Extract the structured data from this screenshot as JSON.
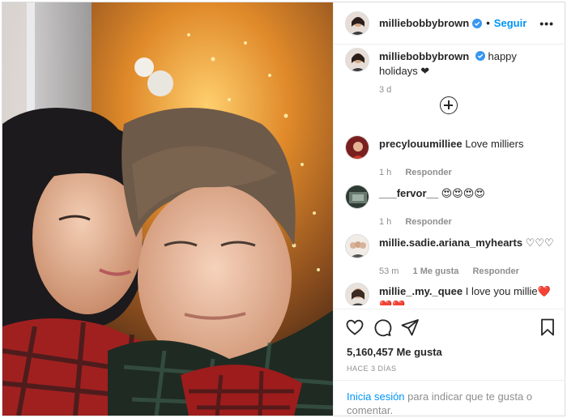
{
  "post": {
    "username": "milliebobbybrown",
    "follow_label": "Seguir",
    "separator": "•",
    "more_label": "•••",
    "photo_description_icon": "photo"
  },
  "caption": {
    "username": "milliebobbybrown",
    "text": "happy holidays ❤",
    "age": "3 d"
  },
  "comments": [
    {
      "username": "precylouumilliee",
      "text": "Love milliers",
      "age": "1 h",
      "likes": "",
      "reply": "Responder"
    },
    {
      "username": "___fervor__",
      "text": "😍😍😍😍",
      "age": "1 h",
      "likes": "",
      "reply": "Responder"
    },
    {
      "username": "millie.sadie.ariana_myhearts",
      "text": "♡♡♡",
      "age": "53 m",
      "likes": "1 Me gusta",
      "reply": "Responder"
    },
    {
      "username": "millie_.my._quee",
      "text": "I love you millie",
      "hearts": "❤️❤️❤️",
      "age": "",
      "likes": "",
      "reply": ""
    }
  ],
  "likes_text": "5,160,457 Me gusta",
  "timestamp": "HACE 3 DÍAS",
  "login": {
    "link": "Inicia sesión",
    "rest": " para indicar que te gusta o comentar."
  },
  "colors": {
    "accent": "#0095f6",
    "text": "#262626",
    "secondary": "#8e8e8e",
    "heart": "#ed4956"
  }
}
